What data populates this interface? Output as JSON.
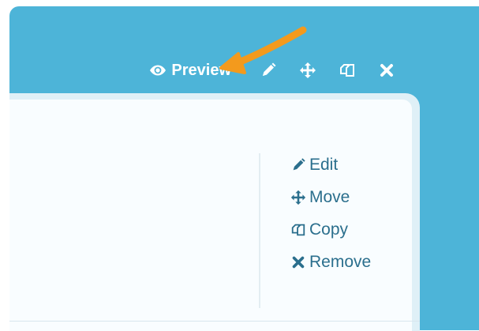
{
  "toolbar": {
    "preview_label": "Preview",
    "icons": [
      "eye-icon",
      "pencil-icon",
      "move-icon",
      "copy-icon",
      "close-icon"
    ]
  },
  "menu": {
    "items": [
      {
        "label": "Edit",
        "icon": "pencil-icon"
      },
      {
        "label": "Move",
        "icon": "move-icon"
      },
      {
        "label": "Copy",
        "icon": "copy-icon"
      },
      {
        "label": "Remove",
        "icon": "close-icon"
      }
    ]
  },
  "colors": {
    "header_bg": "#4db4d8",
    "menu_text": "#2b6f8d",
    "arrow": "#f39a1d"
  }
}
